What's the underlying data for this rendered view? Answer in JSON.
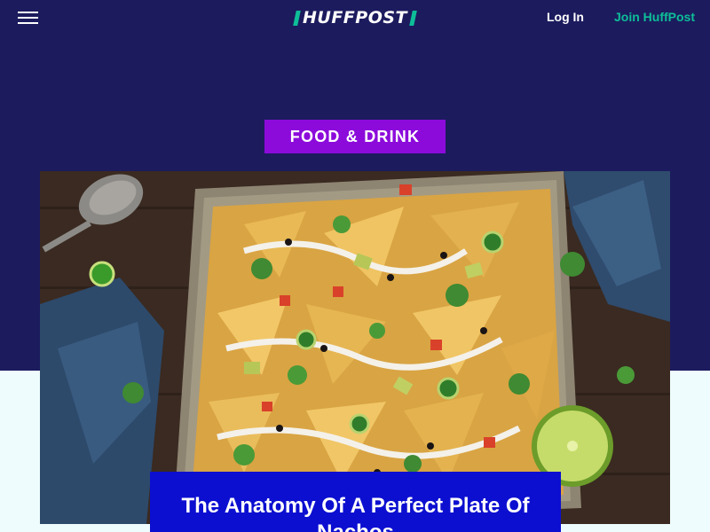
{
  "header": {
    "logo_text": "HUFFPOST",
    "login_label": "Log In",
    "join_label": "Join HuffPost"
  },
  "article": {
    "category": "FOOD & DRINK",
    "headline": "The Anatomy Of A Perfect Plate Of Nachos"
  },
  "colors": {
    "hero_background": "#1c1b5e",
    "page_background": "#eefcfd",
    "brand_green": "#0dbe98",
    "category_purple": "#8c0bdb",
    "headline_blue": "#0c0fd0"
  },
  "icons": {
    "menu": "hamburger-menu-icon"
  }
}
